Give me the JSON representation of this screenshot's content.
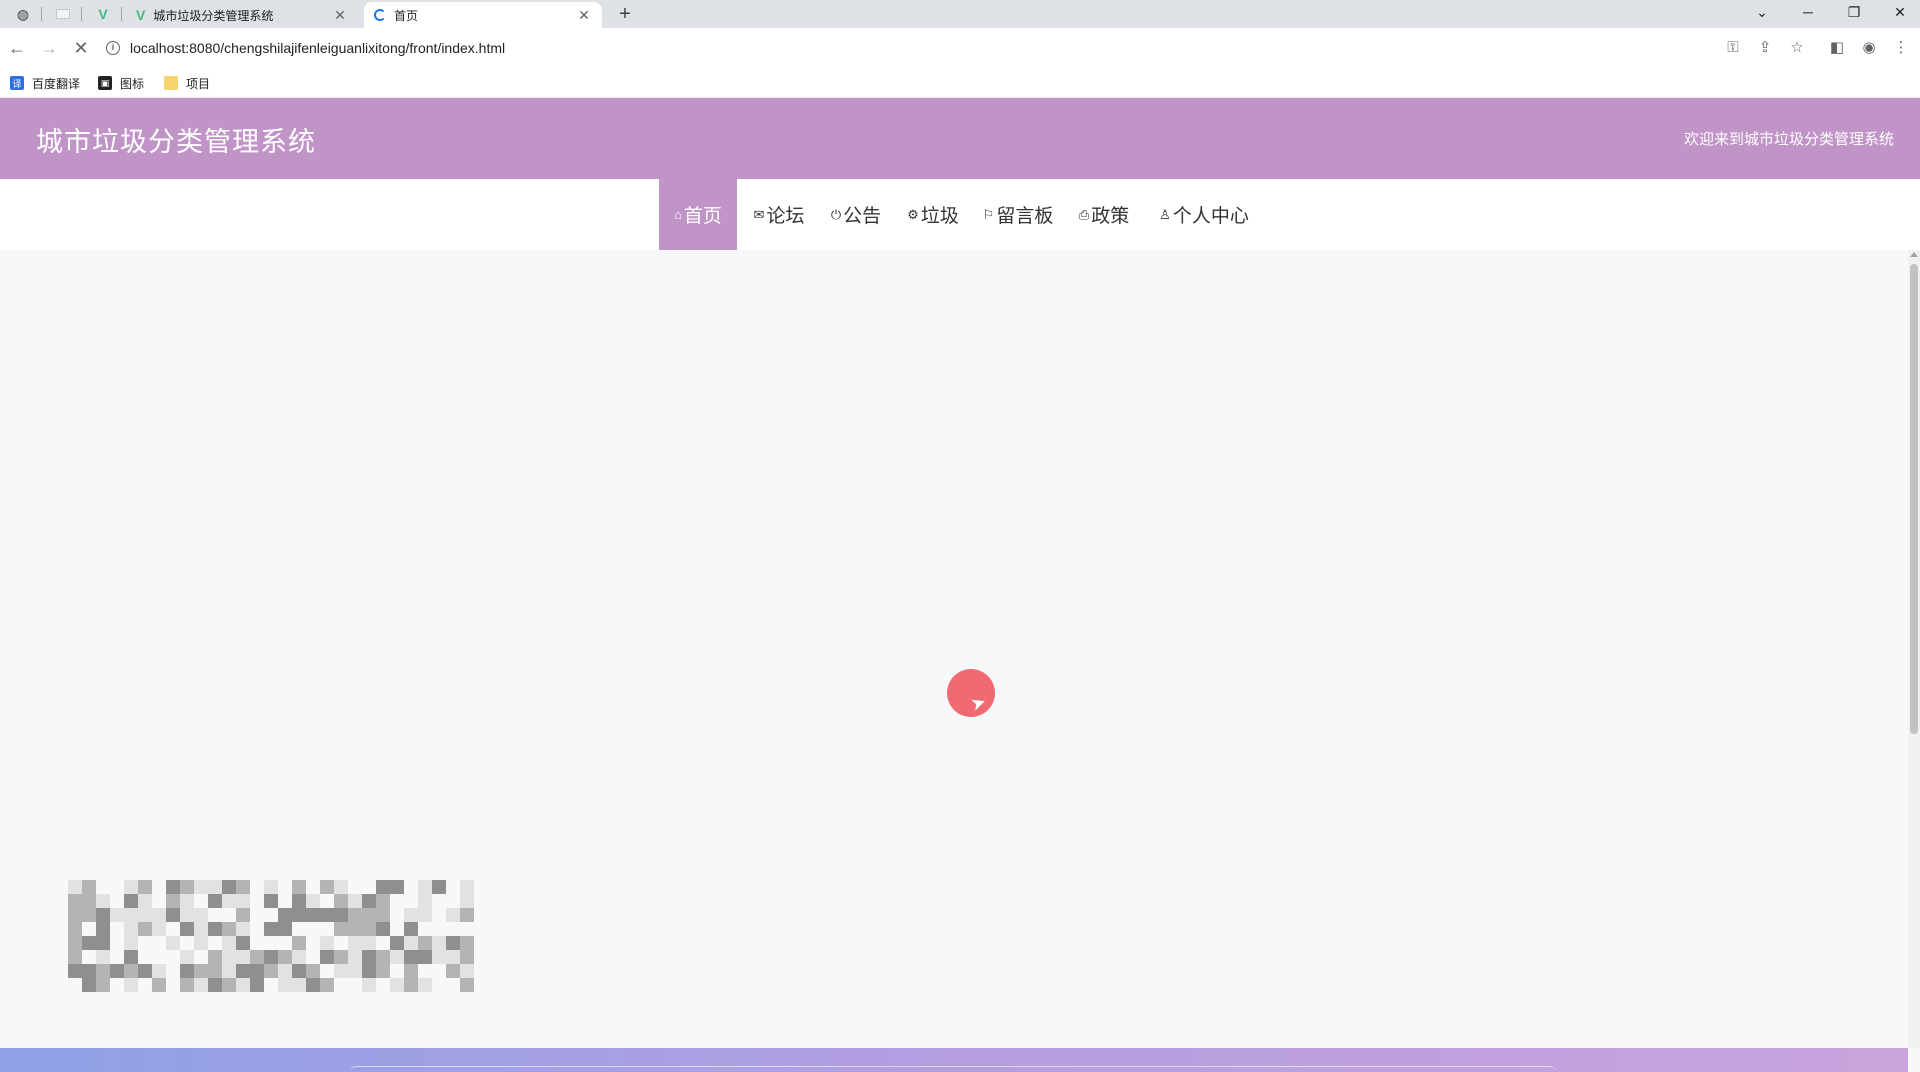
{
  "browser": {
    "tabs": [
      {
        "title": "城市垃圾分类管理系统",
        "active": false
      },
      {
        "title": "首页",
        "active": true
      }
    ],
    "address": "localhost:8080/chengshilajifenleiguanlixitong/front/index.html",
    "bookmarks": [
      {
        "label": "百度翻译",
        "icon": "translate-icon"
      },
      {
        "label": "图标",
        "icon": "image-icon"
      },
      {
        "label": "项目",
        "icon": "folder-icon"
      }
    ]
  },
  "site": {
    "title": "城市垃圾分类管理系统",
    "welcome": "欢迎来到城市垃圾分类管理系统",
    "accent_color": "#c194c8"
  },
  "nav": {
    "items": [
      {
        "label": "首页",
        "icon": "home-icon",
        "glyph": "⌂",
        "active": true
      },
      {
        "label": "论坛",
        "icon": "mail-icon",
        "glyph": "✉",
        "active": false
      },
      {
        "label": "公告",
        "icon": "power-icon",
        "glyph": "⏻",
        "active": false
      },
      {
        "label": "垃圾",
        "icon": "settings-icon",
        "glyph": "⚙",
        "active": false
      },
      {
        "label": "留言板",
        "icon": "flag-icon",
        "glyph": "⚐",
        "active": false
      },
      {
        "label": "政策",
        "icon": "printer-icon",
        "glyph": "⎙",
        "active": false
      },
      {
        "label": "个人中心",
        "icon": "user-icon",
        "glyph": "♙",
        "active": false
      }
    ]
  }
}
